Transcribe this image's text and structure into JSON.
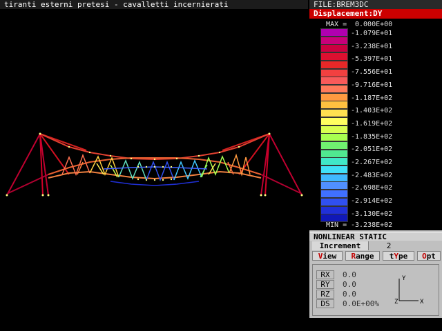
{
  "title": "tiranti esterni pretesi - cavalletti incernierati",
  "file_label": "FILE:BREM3DC",
  "result_label": "Displacement:DY",
  "legend": {
    "max_label": "MAX =",
    "max_value": "0.000E+00",
    "min_label": "MIN =",
    "min_value": "-3.238E+02",
    "values": [
      "-1.079E+01",
      "-3.238E+01",
      "-5.397E+01",
      "-7.556E+01",
      "-9.716E+01",
      "-1.187E+02",
      "-1.403E+02",
      "-1.619E+02",
      "-1.835E+02",
      "-2.051E+02",
      "-2.267E+02",
      "-2.483E+02",
      "-2.698E+02",
      "-2.914E+02",
      "-3.130E+02"
    ],
    "colors": [
      "#b000b0",
      "#c8007a",
      "#cc0040",
      "#dc1030",
      "#e82828",
      "#f24040",
      "#f85a5a",
      "#ff7a5a",
      "#ff9a40",
      "#ffc040",
      "#ffe050",
      "#ffff60",
      "#d8ff50",
      "#a8ff50",
      "#70f070",
      "#50e890",
      "#40e8c8",
      "#40e0f8",
      "#40b8ff",
      "#5090ff",
      "#4070ff",
      "#3050f0",
      "#2030d8",
      "#1018b8"
    ]
  },
  "analysis_type": "NONLINEAR STATIC",
  "increment": {
    "label": "Increment",
    "value": "2"
  },
  "menu": [
    {
      "hotkey": "V",
      "rest": "iew",
      "prefix": ""
    },
    {
      "hotkey": "R",
      "rest": "ange",
      "prefix": ""
    },
    {
      "hotkey": "Y",
      "rest": "pe",
      "prefix": "t"
    },
    {
      "hotkey": "O",
      "rest": "pt",
      "prefix": ""
    }
  ],
  "rotations": [
    {
      "label": "RX",
      "value": "0.0"
    },
    {
      "label": "RY",
      "value": "0.0"
    },
    {
      "label": "RZ",
      "value": "0.0"
    },
    {
      "label": "DS",
      "value": "0.0E+00%"
    }
  ],
  "triad": {
    "y": "Y",
    "z": "Z",
    "x": "X"
  }
}
